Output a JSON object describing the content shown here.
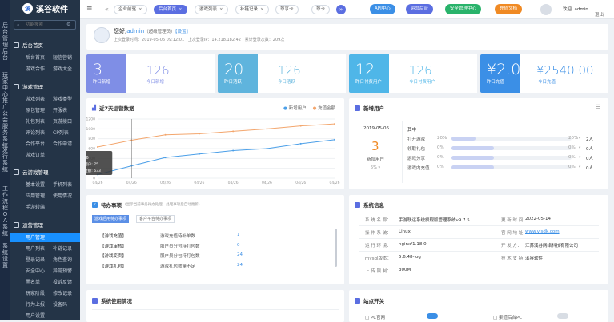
{
  "app": {
    "logo_text": "溪谷软件",
    "logo_mark": "溪"
  },
  "vstrip": {
    "g1": [
      "后",
      "台",
      "管",
      "理",
      "后",
      "台"
    ],
    "g2": [
      "玩",
      "家",
      "中",
      "心",
      "推",
      "广",
      "公",
      "会",
      "服",
      "务",
      "系",
      "统"
    ],
    "g3": [
      "发",
      "行",
      "系",
      "统"
    ],
    "g4": [
      "工",
      "作",
      "流",
      "程",
      "O",
      "A",
      "系",
      "统"
    ],
    "g5": [
      "系",
      "统",
      "设",
      "置"
    ]
  },
  "sidebar": {
    "search_placeholder": "功能搜索",
    "groups": [
      {
        "title": "后台首页",
        "items": [
          [
            "后台首页",
            "短信营销"
          ],
          [
            "游戏合作",
            "游戏大全"
          ]
        ]
      },
      {
        "title": "游戏管理",
        "items": [
          [
            "游戏列表",
            "游戏类型"
          ],
          [
            "原包管理",
            "开服表"
          ],
          [
            "礼包列表",
            "页游接口"
          ],
          [
            "评论列表",
            "CP列表"
          ],
          [
            "合作平台",
            "合作申请"
          ],
          [
            "游戏订单",
            ""
          ]
        ]
      },
      {
        "title": "云游戏管理",
        "items": [
          [
            "基本设置",
            "手机列表"
          ],
          [
            "应用管理",
            "使用情况"
          ],
          [
            "手游转端",
            ""
          ]
        ]
      },
      {
        "title": "运营管理",
        "items": [
          [
            "用户管理",
            ""
          ],
          [
            "用户列表",
            "补链记录"
          ],
          [
            "登录记录",
            "角色查询"
          ],
          [
            "安全中心",
            "异常预警"
          ],
          [
            "黑名单",
            "投诉反馈"
          ],
          [
            "玩家阶段",
            "修改记录"
          ],
          [
            "行为上报",
            "设备码"
          ],
          [
            "用户设置",
            ""
          ]
        ]
      }
    ]
  },
  "topbar": {
    "tabs": [
      "企业前驱",
      "后台首页",
      "游戏列表",
      "补链记录",
      "尊享卡",
      "尊卡"
    ],
    "buttons": [
      "API中心",
      "运营后台",
      "安全管理中心",
      "充值文档"
    ],
    "greeting": "欢迎,",
    "user": "admin",
    "logout": "退出"
  },
  "profile": {
    "hello": "您好,",
    "name": "admin",
    "role": "（超级管理员）",
    "settings": "【设置】",
    "last_login_label": "上次登录时间：",
    "last_login": "2019-05-06 09:12:01",
    "ip_label": "上次登录IP：",
    "ip": "14.218.182.42",
    "count_label": "累计登录次数：",
    "count": "209次"
  },
  "stats": [
    {
      "v": "3",
      "l": "昨日新增",
      "v2": "126",
      "l2": "今日新增",
      "color": "#7f8ee6"
    },
    {
      "v": "20",
      "l": "昨日活跃",
      "v2": "126",
      "l2": "今日活跃",
      "color": "#5fb4dd"
    },
    {
      "v": "12",
      "l": "昨日付费用户",
      "v2": "126",
      "l2": "今日付费用户",
      "color": "#4fb6e8"
    },
    {
      "v": "¥2.00",
      "u": "万",
      "l": "昨日充值",
      "v2": "¥2540.00",
      "l2": "今日充值",
      "color": "#3b8fe6"
    }
  ],
  "chart_card": {
    "title": "近7天运营数据",
    "legend": [
      "新增用户",
      "充值金额"
    ],
    "tooltip": {
      "date": "04/26",
      "s1": "新增用户: 75",
      "s2": "充值金额: 633"
    }
  },
  "chart_data": {
    "type": "line",
    "x": [
      "04/26",
      "04/26",
      "04/26",
      "04/26",
      "04/26",
      "04/26",
      "04/26",
      "04/26"
    ],
    "yticks": [
      "0",
      "200",
      "400",
      "600",
      "800",
      "1000",
      "1200"
    ],
    "ylim": [
      0,
      1200
    ],
    "series": [
      {
        "name": "新增用户",
        "color": "#4b9fe8",
        "values": [
          75,
          250,
          420,
          490,
          560,
          600,
          700,
          780
        ]
      },
      {
        "name": "充值金额",
        "color": "#f3a66d",
        "values": [
          633,
          770,
          880,
          900,
          950,
          1000,
          1060,
          1100
        ]
      }
    ]
  },
  "new_users": {
    "title": "新增用户",
    "date": "2019-05-06",
    "count": "3",
    "label": "新增用户",
    "pct": "5%",
    "total_label": "其中",
    "rows": [
      {
        "name": "打开游戏",
        "pct": "20%",
        "val": "2人",
        "fill": 0.2
      },
      {
        "name": "领取礼包",
        "pct": "0%",
        "val": "0人",
        "fill": 0.35
      },
      {
        "name": "游戏分享",
        "pct": "0%",
        "val": "0人",
        "fill": 0.35
      },
      {
        "name": "游戏内充值",
        "pct": "0%",
        "val": "0人",
        "fill": 0.35
      }
    ]
  },
  "todo": {
    "title": "待办事项",
    "hint": "(显示当前事务待办处理，处理事项后自动更新)",
    "tabs": [
      "游戏后用待办事项",
      "客户平台待办事项"
    ],
    "rows": [
      [
        "【游戏充值】",
        "游戏充值待补单数",
        "1"
      ],
      [
        "【游戏审核】",
        "服户员分包待打包数",
        "0"
      ],
      [
        "【游戏变卖】",
        "服户员分包待打包数",
        "24"
      ],
      [
        "【游戏礼包】",
        "游戏礼包数量不足",
        "24"
      ]
    ]
  },
  "sysinfo": {
    "title": "系统信息",
    "rows": [
      [
        "系 统 名 称：",
        "手游联运系统旗舰版管理系统v9.7.5",
        "更 新 时 间：",
        "2022-05-14"
      ],
      [
        "操 作 系 统：",
        "Linux",
        "官 网 地 址：",
        "www.vlsdk.com"
      ],
      [
        "运 行 环 境：",
        "nginx/1.18.0",
        "开 发 方：",
        "江苏溪谷网络科技有限公司"
      ],
      [
        "mysql版本：",
        "5.6.48-log",
        "技 术 支 持：",
        "溪谷软件"
      ],
      [
        "上 传 限 制：",
        "300M",
        "",
        ""
      ]
    ]
  },
  "usage": {
    "title": "系统使用情况"
  },
  "site": {
    "title": "站点开关",
    "items": [
      "PC官网",
      "渠道后台PC"
    ]
  }
}
